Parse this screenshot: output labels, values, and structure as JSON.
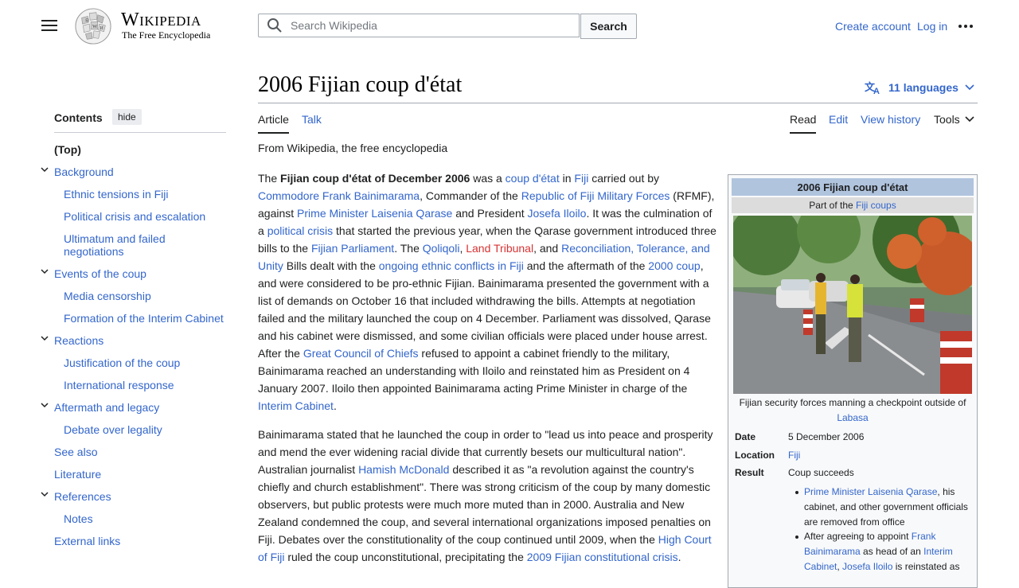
{
  "header": {
    "wordmark": "Wikipedia",
    "tagline": "The Free Encyclopedia",
    "search_placeholder": "Search Wikipedia",
    "search_button": "Search",
    "create_account": "Create account",
    "log_in": "Log in",
    "menu_icon": "hamburger-icon",
    "more_icon": "ellipsis-icon"
  },
  "toc": {
    "title": "Contents",
    "hide": "hide",
    "items": [
      {
        "label": "(Top)"
      },
      {
        "label": "Background"
      },
      {
        "label": "Ethnic tensions in Fiji"
      },
      {
        "label": "Political crisis and escalation"
      },
      {
        "label": "Ultimatum and failed"
      },
      {
        "label": "negotiations"
      },
      {
        "label": "Events of the coup"
      },
      {
        "label": "Media censorship"
      },
      {
        "label": "Formation of the Interim Cabinet"
      },
      {
        "label": "Reactions"
      },
      {
        "label": "Justification of the coup"
      },
      {
        "label": "International response"
      },
      {
        "label": "Aftermath and legacy"
      },
      {
        "label": "Debate over legality"
      },
      {
        "label": "See also"
      },
      {
        "label": "Literature"
      },
      {
        "label": "References"
      },
      {
        "label": "Notes"
      },
      {
        "label": "External links"
      }
    ]
  },
  "article": {
    "title": "2006 Fijian coup d'état",
    "languages": "11 languages",
    "tabs": {
      "article": "Article",
      "talk": "Talk",
      "read": "Read",
      "edit": "Edit",
      "history": "View history",
      "tools": "Tools"
    },
    "from": "From Wikipedia, the free encyclopedia",
    "p1": [
      "The ",
      "Fijian coup d'état of December 2006",
      " was a ",
      "coup d'état",
      " in ",
      "Fiji",
      " carried out by ",
      "Commodore Frank Bainimarama",
      ", Commander of the ",
      "Republic of Fiji Military Forces",
      " (RFMF), against ",
      "Prime Minister Laisenia Qarase",
      " and President ",
      "Josefa Iloilo",
      ". It was the culmination of a ",
      "political crisis",
      " that started the previous year, when the Qarase government introduced three bills to the ",
      "Fijian Parliament",
      ". The ",
      "Qoliqoli",
      ", ",
      "Land Tribunal",
      ", and ",
      "Reconciliation, Tolerance, and Unity",
      " Bills dealt with the ",
      "ongoing ethnic conflicts in Fiji",
      " and the aftermath of the ",
      "2000 coup",
      ", and were considered to be pro-ethnic Fijian. Bainimarama presented the government with a list of demands on October 16 that included withdrawing the bills. Attempts at negotiation failed and the military launched the coup on 4 December. Parliament was dissolved, Qarase and his cabinet were dismissed, and some civilian officials were placed under house arrest. After the ",
      "Great Council of Chiefs",
      " refused to appoint a cabinet friendly to the military, Bainimarama reached an understanding with Iloilo and reinstated him as President on 4 January 2007. Iloilo then appointed Bainimarama acting Prime Minister in charge of the ",
      "Interim Cabinet",
      "."
    ],
    "p2": [
      "Bainimarama stated that he launched the coup in order to \"lead us into peace and prosperity and mend the ever widening racial divide that currently besets our multicultural nation\". Australian journalist ",
      "Hamish McDonald",
      " described it as \"a revolution against the country's chiefly and church establishment\". There was strong criticism of the coup by many domestic observers, but public protests were much more muted than in 2000. Australia and New Zealand condemned the coup, and several international organizations imposed penalties on Fiji. Debates over the constitutionality of the coup continued until 2009, when the ",
      "High Court of Fiji",
      " ruled the coup unconstitutional, precipitating the ",
      "2009 Fijian constitutional crisis",
      "."
    ]
  },
  "infobox": {
    "title": "2006 Fijian coup d'état",
    "sub_prefix": "Part of the ",
    "sub_link": "Fiji coups",
    "caption": "Fijian security forces manning a checkpoint outside of",
    "caption_link": "Labasa",
    "date_label": "Date",
    "date_value": "5 December 2006",
    "location_label": "Location",
    "location_value": "Fiji",
    "result_label": "Result",
    "result_value": "Coup succeeds",
    "result_items": [
      [
        "Prime Minister Laisenia Qarase",
        ", his cabinet, and other government officials are removed from office"
      ],
      [
        "After agreeing to appoint ",
        "Frank Bainimarama",
        " as head of an ",
        "Interim Cabinet",
        ", ",
        "Josefa Iloilo",
        " is reinstated as"
      ]
    ]
  },
  "colors": {
    "link": "#3366cc",
    "red_link": "#d73333",
    "infobox_title_bg": "#b0c4de",
    "infobox_sub_bg": "#dcdcdc"
  }
}
